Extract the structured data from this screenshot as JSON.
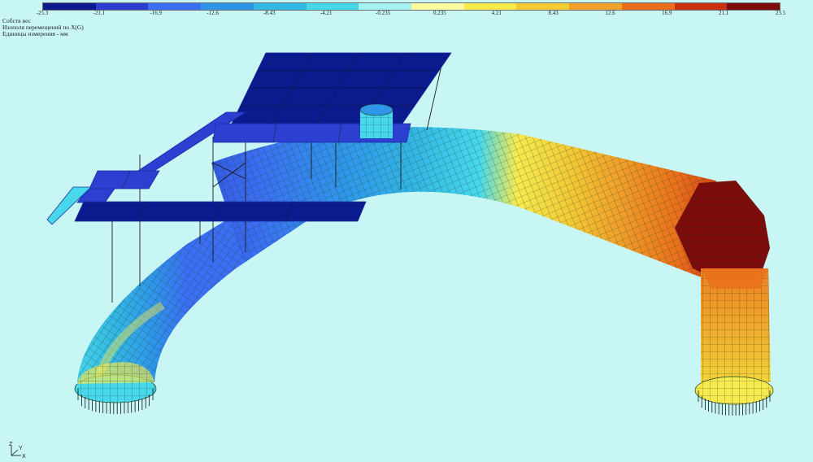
{
  "legend": {
    "ticks": [
      "-25.3",
      "-21.1",
      "-16.9",
      "-12.6",
      "-8.43",
      "-4.21",
      "-0.235",
      "0.235",
      "4.21",
      "8.43",
      "12.6",
      "16.9",
      "21.1",
      "23.5"
    ],
    "colors": [
      "#0b1a8c",
      "#2c3fd0",
      "#3b6ef2",
      "#2f96ea",
      "#33b8e4",
      "#48d8ec",
      "#a6f2f2",
      "#fbfba0",
      "#f6ea4f",
      "#f2cc37",
      "#f0a22a",
      "#ea6f1c",
      "#c9300e",
      "#7e0b0b"
    ]
  },
  "info": {
    "line1": "Собств вес",
    "line2": "Изополя перемещений по X(G)",
    "line3": "Единицы измерения - мм"
  },
  "axes": {
    "z": "Z",
    "y": "Y",
    "x": "X"
  },
  "icons": {
    "triad": "axis-triad-icon"
  }
}
